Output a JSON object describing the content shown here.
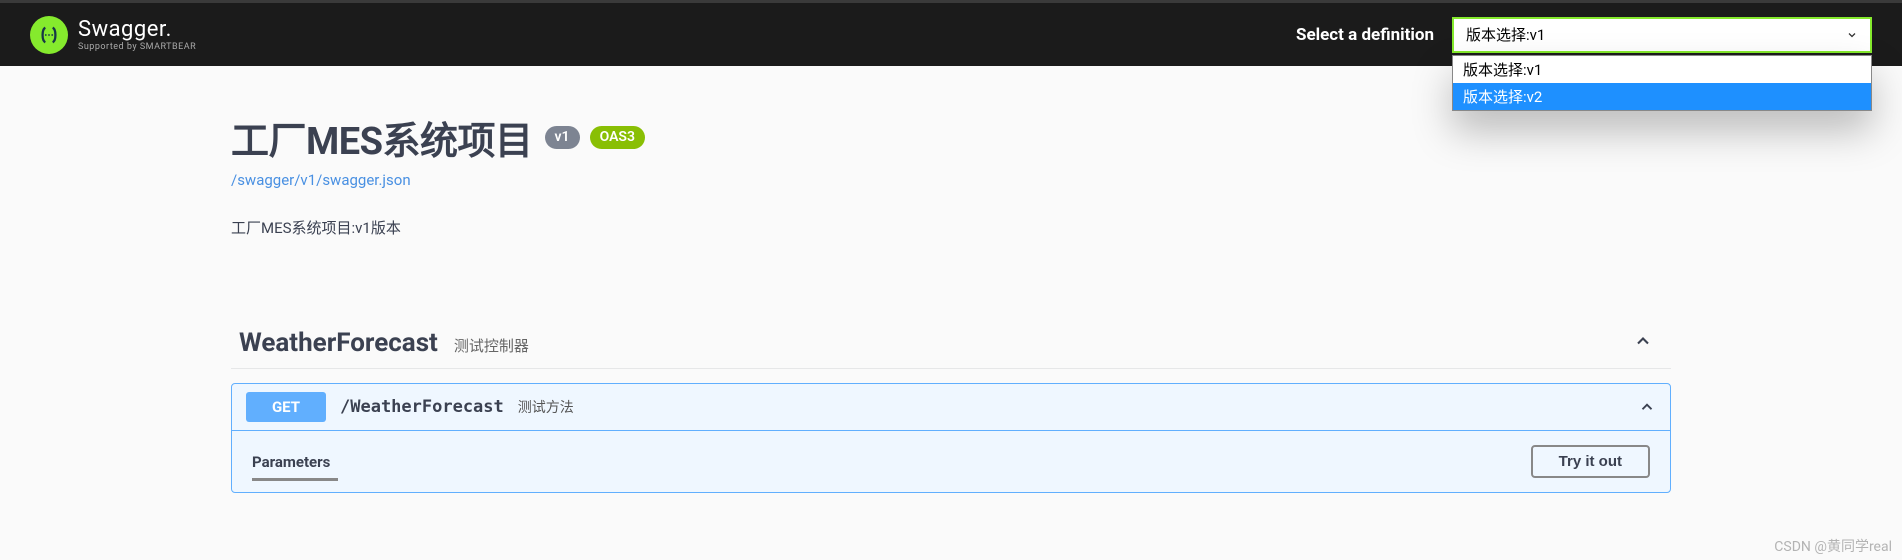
{
  "header": {
    "logo_text": "Swagger.",
    "logo_subtitle": "Supported by SMARTBEAR",
    "select_label": "Select a definition",
    "selected_option": "版本选择:v1",
    "options": [
      "版本选择:v1",
      "版本选择:v2"
    ]
  },
  "api": {
    "title": "工厂MES系统项目",
    "version_badge": "v1",
    "oas_badge": "OAS3",
    "url": "/swagger/v1/swagger.json",
    "description": "工厂MES系统项目:v1版本"
  },
  "tag": {
    "name": "WeatherForecast",
    "description": "测试控制器"
  },
  "operation": {
    "method": "GET",
    "path": "/WeatherForecast",
    "summary": "测试方法",
    "parameters_label": "Parameters",
    "try_button": "Try it out"
  },
  "watermark": "CSDN @黄同学real"
}
